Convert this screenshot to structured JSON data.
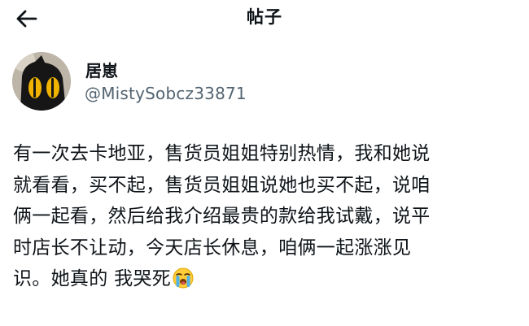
{
  "header": {
    "back_icon": "arrow-left-icon",
    "title": "帖子"
  },
  "author": {
    "avatar_icon": "cartoon-cat-avatar",
    "name": "居崽",
    "handle": "@MistySobcz33871"
  },
  "post": {
    "text": "有一次去卡地亚，售货员姐姐特别热情，我和她说\n就看看，买不起，售货员姐姐说她也买不起，说咱\n俩一起看，然后给我介绍最贵的款给我试戴，说平\n时店长不让动，今天店长休息，咱俩一起涨涨见\n识。她真的 我哭死",
    "trailing_emoji": "loudly-crying-face-icon"
  }
}
